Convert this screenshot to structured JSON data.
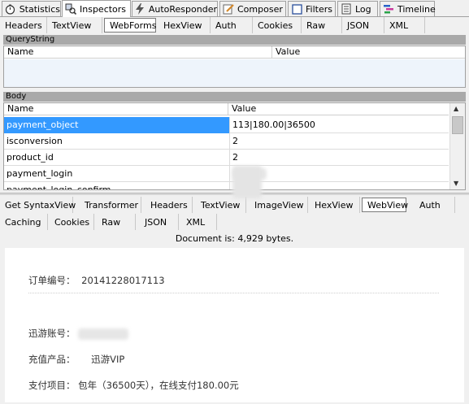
{
  "top_tabs": [
    {
      "label": "Statistics",
      "icon": "stopwatch-icon"
    },
    {
      "label": "Inspectors",
      "icon": "magnifier-icon"
    },
    {
      "label": "AutoResponder",
      "icon": "lightning-icon"
    },
    {
      "label": "Composer",
      "icon": "pencil-icon"
    },
    {
      "label": "Filters",
      "icon": "checkbox-icon"
    },
    {
      "label": "Log",
      "icon": "document-icon"
    },
    {
      "label": "Timeline",
      "icon": "timeline-icon"
    }
  ],
  "request_tabs": [
    "Headers",
    "TextView",
    "WebForms",
    "HexView",
    "Auth",
    "Cookies",
    "Raw",
    "JSON",
    "XML"
  ],
  "querystring": {
    "title": "QueryString",
    "col_name": "Name",
    "col_value": "Value"
  },
  "body": {
    "title": "Body",
    "col_name": "Name",
    "col_value": "Value",
    "rows": [
      {
        "name": "payment_object",
        "value": "113|180.00|36500"
      },
      {
        "name": "isconversion",
        "value": "2"
      },
      {
        "name": "product_id",
        "value": "2"
      },
      {
        "name": "payment_login",
        "value": ""
      },
      {
        "name": "payment_login_confirm",
        "value": ""
      }
    ]
  },
  "response_tabs_row1": [
    "Get SyntaxView",
    "Transformer",
    "Headers",
    "TextView",
    "ImageView",
    "HexView",
    "WebView",
    "Auth"
  ],
  "response_tabs_row2": [
    "Caching",
    "Cookies",
    "Raw",
    "JSON",
    "XML"
  ],
  "document_info": "Document is: 4,929 bytes.",
  "webview": {
    "order_label": "订单编号：",
    "order_number": "20141228017113",
    "account_label": "迅游账号：",
    "product_label": "充值产品：",
    "product_value": "迅游VIP",
    "payment_label": "支付项目：",
    "payment_value": "包年（36500天），在线支付180.00元"
  }
}
